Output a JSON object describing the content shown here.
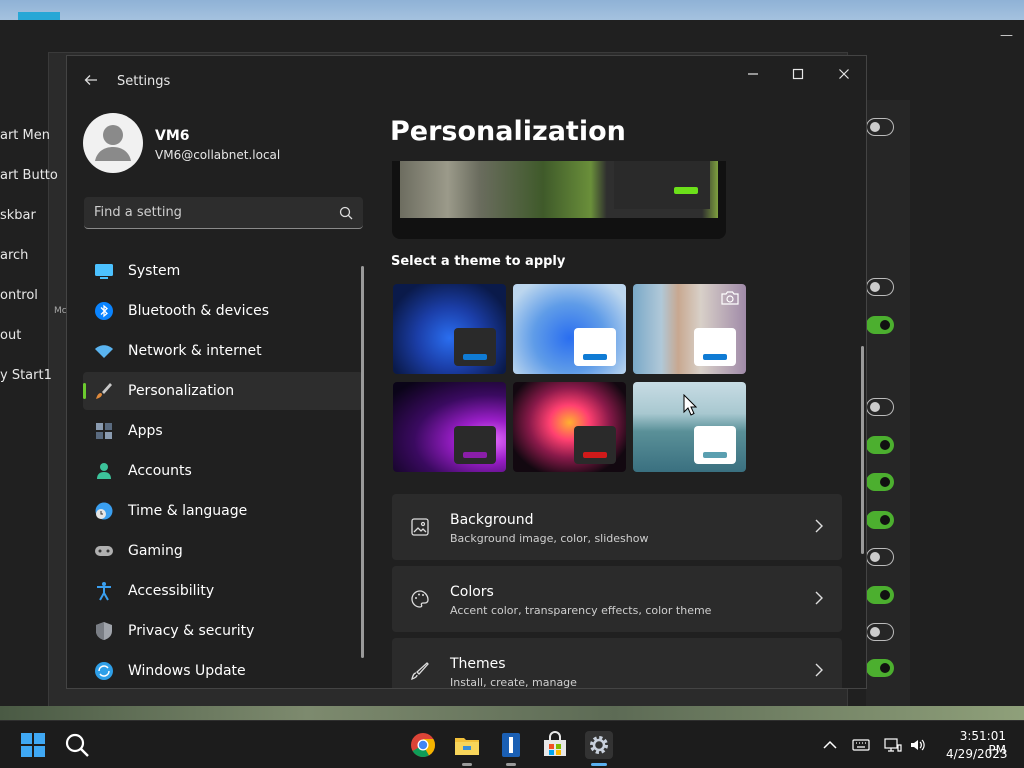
{
  "back_window": {
    "labels": [
      "art Men",
      "art Butto",
      "skbar",
      "arch",
      "ontrol",
      "out",
      "y Start1"
    ],
    "small_label": "Mc"
  },
  "window": {
    "title": "Settings",
    "minimize_label": "—",
    "maximize_label": "☐",
    "close_label": "✕"
  },
  "profile": {
    "name": "VM6",
    "email": "VM6@collabnet.local"
  },
  "search": {
    "placeholder": "Find a setting"
  },
  "nav": {
    "items": [
      {
        "label": "System",
        "icon": "monitor-icon",
        "color": "#4cc2ff"
      },
      {
        "label": "Bluetooth & devices",
        "icon": "bluetooth-icon",
        "color": "#0a84ff"
      },
      {
        "label": "Network & internet",
        "icon": "wifi-icon",
        "color": "#5ab4f0"
      },
      {
        "label": "Personalization",
        "icon": "paintbrush-icon",
        "color": "#e08a3c"
      },
      {
        "label": "Apps",
        "icon": "apps-icon",
        "color": "#8a9bb0"
      },
      {
        "label": "Accounts",
        "icon": "person-icon",
        "color": "#3cc29a"
      },
      {
        "label": "Time & language",
        "icon": "globe-clock-icon",
        "color": "#3a9ff0"
      },
      {
        "label": "Gaming",
        "icon": "controller-icon",
        "color": "#b0b0b0"
      },
      {
        "label": "Accessibility",
        "icon": "accessibility-icon",
        "color": "#3a9ff0"
      },
      {
        "label": "Privacy & security",
        "icon": "shield-icon",
        "color": "#a0a4ab"
      },
      {
        "label": "Windows Update",
        "icon": "update-icon",
        "color": "#2e9fe8"
      }
    ],
    "active_index": 3
  },
  "content": {
    "page_title": "Personalization",
    "theme_heading": "Select a theme to apply",
    "themes": [
      {
        "name": "windows-dark-theme",
        "accent": "#0f7bd4",
        "chip": "#2a2a2a"
      },
      {
        "name": "windows-light-theme",
        "accent": "#0f7bd4",
        "chip": "#ffffff"
      },
      {
        "name": "spotlight-theme",
        "accent": "#0f7bd4",
        "chip": "#ffffff"
      },
      {
        "name": "glow-theme",
        "accent": "#8a1ea8",
        "chip": "#2a2a2a"
      },
      {
        "name": "captured-motion-theme",
        "accent": "#d01a1a",
        "chip": "#2a2a2a"
      },
      {
        "name": "flow-theme",
        "accent": "#5a9fb0",
        "chip": "#ffffff"
      }
    ],
    "rows": [
      {
        "title": "Background",
        "subtitle": "Background image, color, slideshow",
        "icon": "image-icon"
      },
      {
        "title": "Colors",
        "subtitle": "Accent color, transparency effects, color theme",
        "icon": "palette-icon"
      },
      {
        "title": "Themes",
        "subtitle": "Install, create, manage",
        "icon": "brush-icon"
      }
    ]
  },
  "taskbar": {
    "apps": [
      "start-icon",
      "search-icon",
      "chrome-icon",
      "file-explorer-icon",
      "app-icon",
      "store-icon",
      "settings-icon"
    ],
    "time": "3:51:01 PM",
    "date": "4/29/2023"
  },
  "colors": {
    "accent": "#6ccb2f",
    "window_bg": "#202020",
    "card_bg": "#2b2b2b"
  }
}
